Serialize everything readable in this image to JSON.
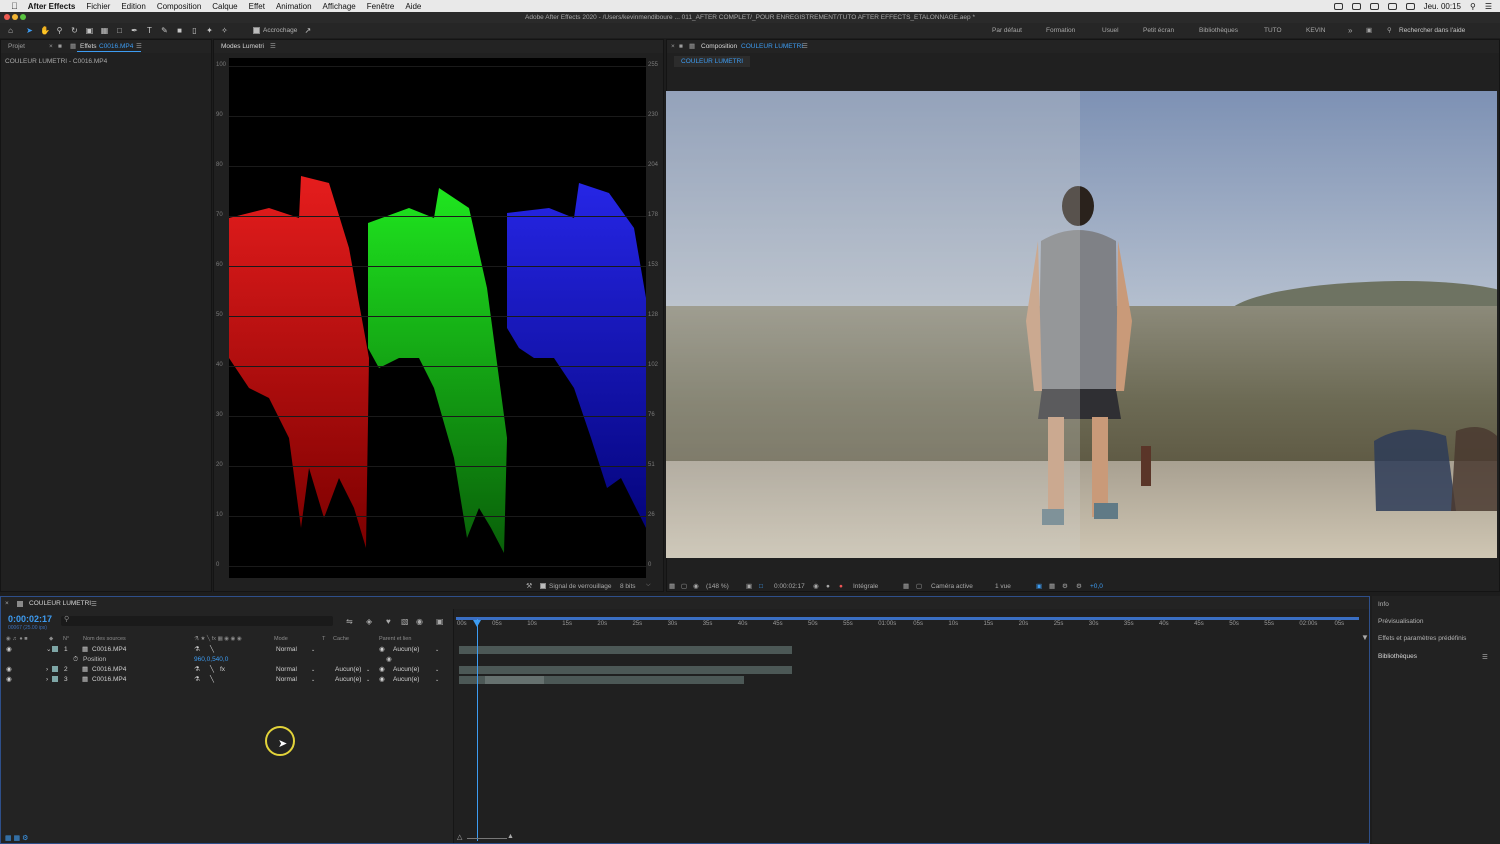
{
  "menubar": {
    "app": "After Effects",
    "items": [
      "Fichier",
      "Edition",
      "Composition",
      "Calque",
      "Effet",
      "Animation",
      "Affichage",
      "Fenêtre",
      "Aide"
    ],
    "clock": "Jeu. 00:15"
  },
  "window": {
    "title": "Adobe After Effects 2020 - /Users/kevinmendiboure ... 011_AFTER COMPLET/_POUR ENREGISTREMENT/TUTO AFTER EFFECTS_ETALONNAGE.aep *"
  },
  "toolbar": {
    "snapping": "Accrochage",
    "workspaces": [
      "Par défaut",
      "Formation",
      "Usuel",
      "Petit écran",
      "Bibliothèques",
      "TUTO",
      "KEVIN"
    ],
    "search_placeholder": "Rechercher dans l'aide"
  },
  "project_panel": {
    "tab_project": "Projet",
    "tab_effects": "Effets",
    "tab_effects_layer": "C0016.MP4",
    "breadcrumb": "COULEUR LUMETRI - C0016.MP4"
  },
  "scope_panel": {
    "tab": "Modes Lumetri",
    "left_ticks": [
      "100",
      "90",
      "80",
      "70",
      "60",
      "50",
      "40",
      "30",
      "20",
      "10",
      "0"
    ],
    "right_ticks": [
      "255",
      "230",
      "204",
      "178",
      "153",
      "128",
      "102",
      "76",
      "51",
      "26",
      "0"
    ],
    "clamp_label": "Signal de verrouillage",
    "bit_depth": "8 bits"
  },
  "comp_panel": {
    "tab_label": "Composition",
    "comp_name": "COULEUR LUMETRI",
    "sub_tab": "COULEUR LUMETRI",
    "zoom": "(148 %)",
    "timecode": "0:00:02:17",
    "resolution": "Intégrale",
    "camera": "Caméra active",
    "views": "1 vue",
    "exposure": "+0,0"
  },
  "timeline": {
    "comp_tab": "COULEUR LUMETRI",
    "timecode": "0:00:02:17",
    "fps": "00067 (25.00 ips)",
    "headers": {
      "num": "N°",
      "source": "Nom des sources",
      "mode": "Mode",
      "t": "T",
      "matte": "Cache",
      "parent": "Parent et lien"
    },
    "layers": [
      {
        "num": "1",
        "name": "C0016.MP4",
        "mode": "Normal",
        "matte": "",
        "parent": "Aucun(e)"
      },
      {
        "num": "2",
        "name": "C0016.MP4",
        "mode": "Normal",
        "matte": "Aucun(e)",
        "parent": "Aucun(e)"
      },
      {
        "num": "3",
        "name": "C0016.MP4",
        "mode": "Normal",
        "matte": "Aucun(e)",
        "parent": "Aucun(e)"
      }
    ],
    "position_label": "Position",
    "position_value": "960,0,540,0",
    "ruler": [
      "00s",
      "05s",
      "10s",
      "15s",
      "20s",
      "25s",
      "30s",
      "35s",
      "40s",
      "45s",
      "50s",
      "55s",
      "01:00s",
      "05s",
      "10s",
      "15s",
      "20s",
      "25s",
      "30s",
      "35s",
      "40s",
      "45s",
      "50s",
      "55s",
      "02:00s",
      "05s"
    ]
  },
  "right_panel": {
    "items": [
      "Info",
      "Prévisualisation",
      "Effets et paramètres prédéfinis",
      "Bibliothèques"
    ]
  },
  "colors": {
    "accent": "#3d9cf2",
    "panel": "#202020",
    "cursor_ring": "#e2d33a"
  }
}
